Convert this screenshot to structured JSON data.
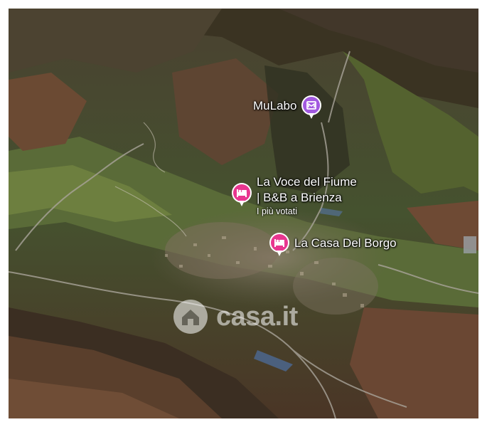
{
  "map": {
    "type": "satellite-3d",
    "colors": {
      "poi_pin_lodging": "#e8368f",
      "poi_pin_museum": "#a259e0",
      "label_text": "#ffffff"
    },
    "pois": [
      {
        "label": "MuLabo",
        "icon": "museum-icon"
      },
      {
        "label_line1": "La Voce del Fiume",
        "label_line2": "| B&B a Brienza",
        "sublabel": "I più votati",
        "icon": "bed-icon"
      },
      {
        "label": "La Casa Del Borgo",
        "icon": "bed-icon"
      }
    ],
    "watermark": {
      "text": "casa.it",
      "icon": "house-logo-icon"
    }
  }
}
